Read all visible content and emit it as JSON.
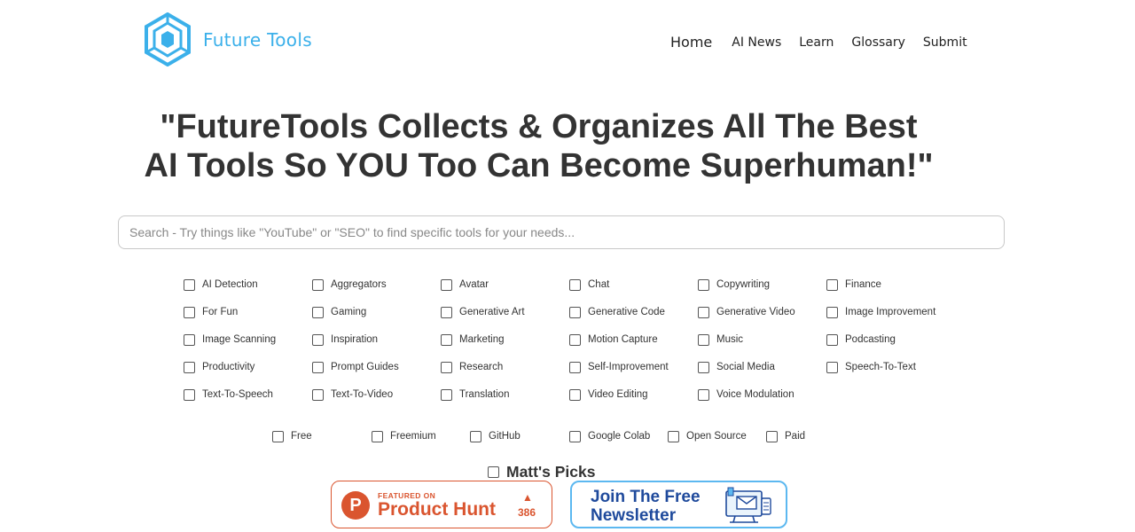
{
  "header": {
    "logo_text": "Future Tools",
    "nav": [
      "Home",
      "AI News",
      "Learn",
      "Glossary",
      "Submit"
    ]
  },
  "hero": {
    "line1": "\"FutureTools Collects & Organizes All The Best",
    "line2": "AI Tools So YOU Too Can Become Superhuman!\""
  },
  "search": {
    "placeholder": "Search - Try things like \"YouTube\" or \"SEO\" to find specific tools for your needs...",
    "value": ""
  },
  "categories": [
    "AI Detection",
    "Aggregators",
    "Avatar",
    "Chat",
    "Copywriting",
    "Finance",
    "For Fun",
    "Gaming",
    "Generative Art",
    "Generative Code",
    "Generative Video",
    "Image Improvement",
    "Image Scanning",
    "Inspiration",
    "Marketing",
    "Motion Capture",
    "Music",
    "Podcasting",
    "Productivity",
    "Prompt Guides",
    "Research",
    "Self-Improvement",
    "Social Media",
    "Speech-To-Text",
    "Text-To-Speech",
    "Text-To-Video",
    "Translation",
    "Video Editing",
    "Voice Modulation"
  ],
  "pricing": [
    "Free",
    "Freemium",
    "GitHub",
    "Google Colab",
    "Open Source",
    "Paid"
  ],
  "picks": {
    "label": "Matt's Picks"
  },
  "product_hunt": {
    "featured": "FEATURED ON",
    "name": "Product Hunt",
    "votes": "386",
    "letter": "P"
  },
  "newsletter": {
    "line1": "Join The Free",
    "line2": "Newsletter"
  },
  "colors": {
    "accent": "#3bb0ea",
    "product_hunt": "#da552f",
    "newsletter_text": "#1f4a9c"
  }
}
